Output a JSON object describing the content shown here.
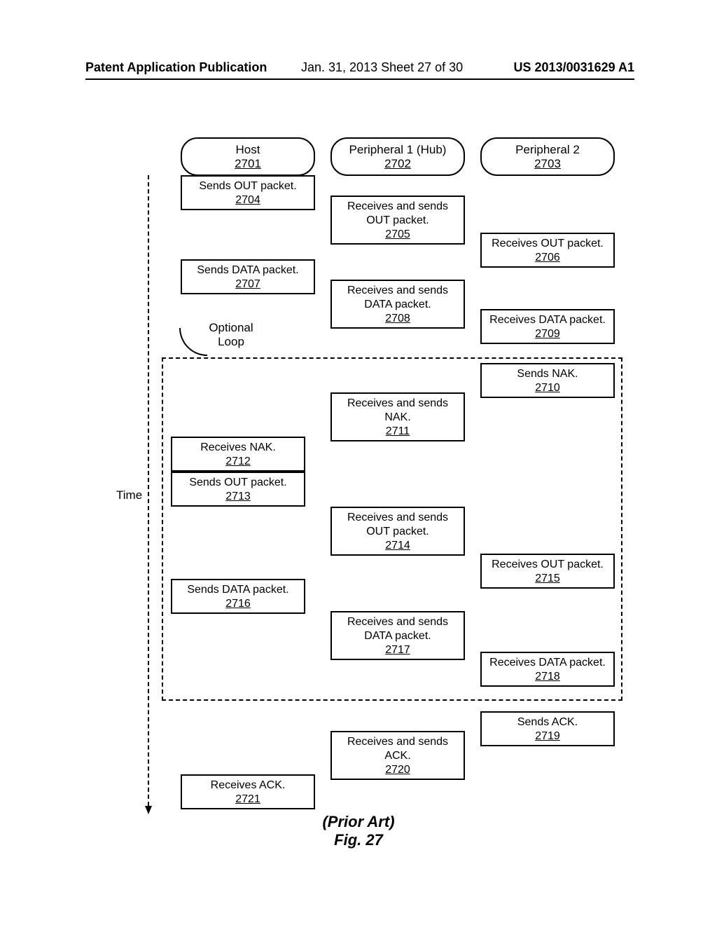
{
  "header": {
    "left": "Patent Application Publication",
    "center": "Jan. 31, 2013  Sheet 27 of 30",
    "right": "US 2013/0031629 A1"
  },
  "columns": {
    "host": {
      "label": "Host",
      "ref": "2701"
    },
    "p1": {
      "label": "Peripheral 1 (Hub)",
      "ref": "2702"
    },
    "p2": {
      "label": "Peripheral 2",
      "ref": "2703"
    }
  },
  "time_label": "Time",
  "loop_label_line1": "Optional",
  "loop_label_line2": "Loop",
  "steps": {
    "s2704": {
      "text": "Sends OUT packet.",
      "ref": "2704"
    },
    "s2705": {
      "text": "Receives and sends OUT packet.",
      "ref": "2705"
    },
    "s2706": {
      "text": "Receives OUT packet.",
      "ref": "2706"
    },
    "s2707": {
      "text": "Sends DATA packet.",
      "ref": "2707"
    },
    "s2708": {
      "text": "Receives and sends DATA packet.",
      "ref": "2708"
    },
    "s2709": {
      "text": "Receives DATA packet.",
      "ref": "2709"
    },
    "s2710": {
      "text": "Sends NAK.",
      "ref": "2710"
    },
    "s2711": {
      "text": "Receives and sends NAK.",
      "ref": "2711"
    },
    "s2712": {
      "text": "Receives NAK.",
      "ref": "2712"
    },
    "s2713": {
      "text": "Sends OUT packet.",
      "ref": "2713"
    },
    "s2714": {
      "text": "Receives and sends OUT packet.",
      "ref": "2714"
    },
    "s2715": {
      "text": "Receives OUT packet.",
      "ref": "2715"
    },
    "s2716": {
      "text": "Sends DATA packet.",
      "ref": "2716"
    },
    "s2717": {
      "text": "Receives and sends DATA packet.",
      "ref": "2717"
    },
    "s2718": {
      "text": "Receives DATA packet.",
      "ref": "2718"
    },
    "s2719": {
      "text": "Sends ACK.",
      "ref": "2719"
    },
    "s2720": {
      "text": "Receives and sends ACK.",
      "ref": "2720"
    },
    "s2721": {
      "text": "Receives ACK.",
      "ref": "2721"
    }
  },
  "caption": {
    "prior": "(Prior Art)",
    "fig": "Fig. 27"
  }
}
